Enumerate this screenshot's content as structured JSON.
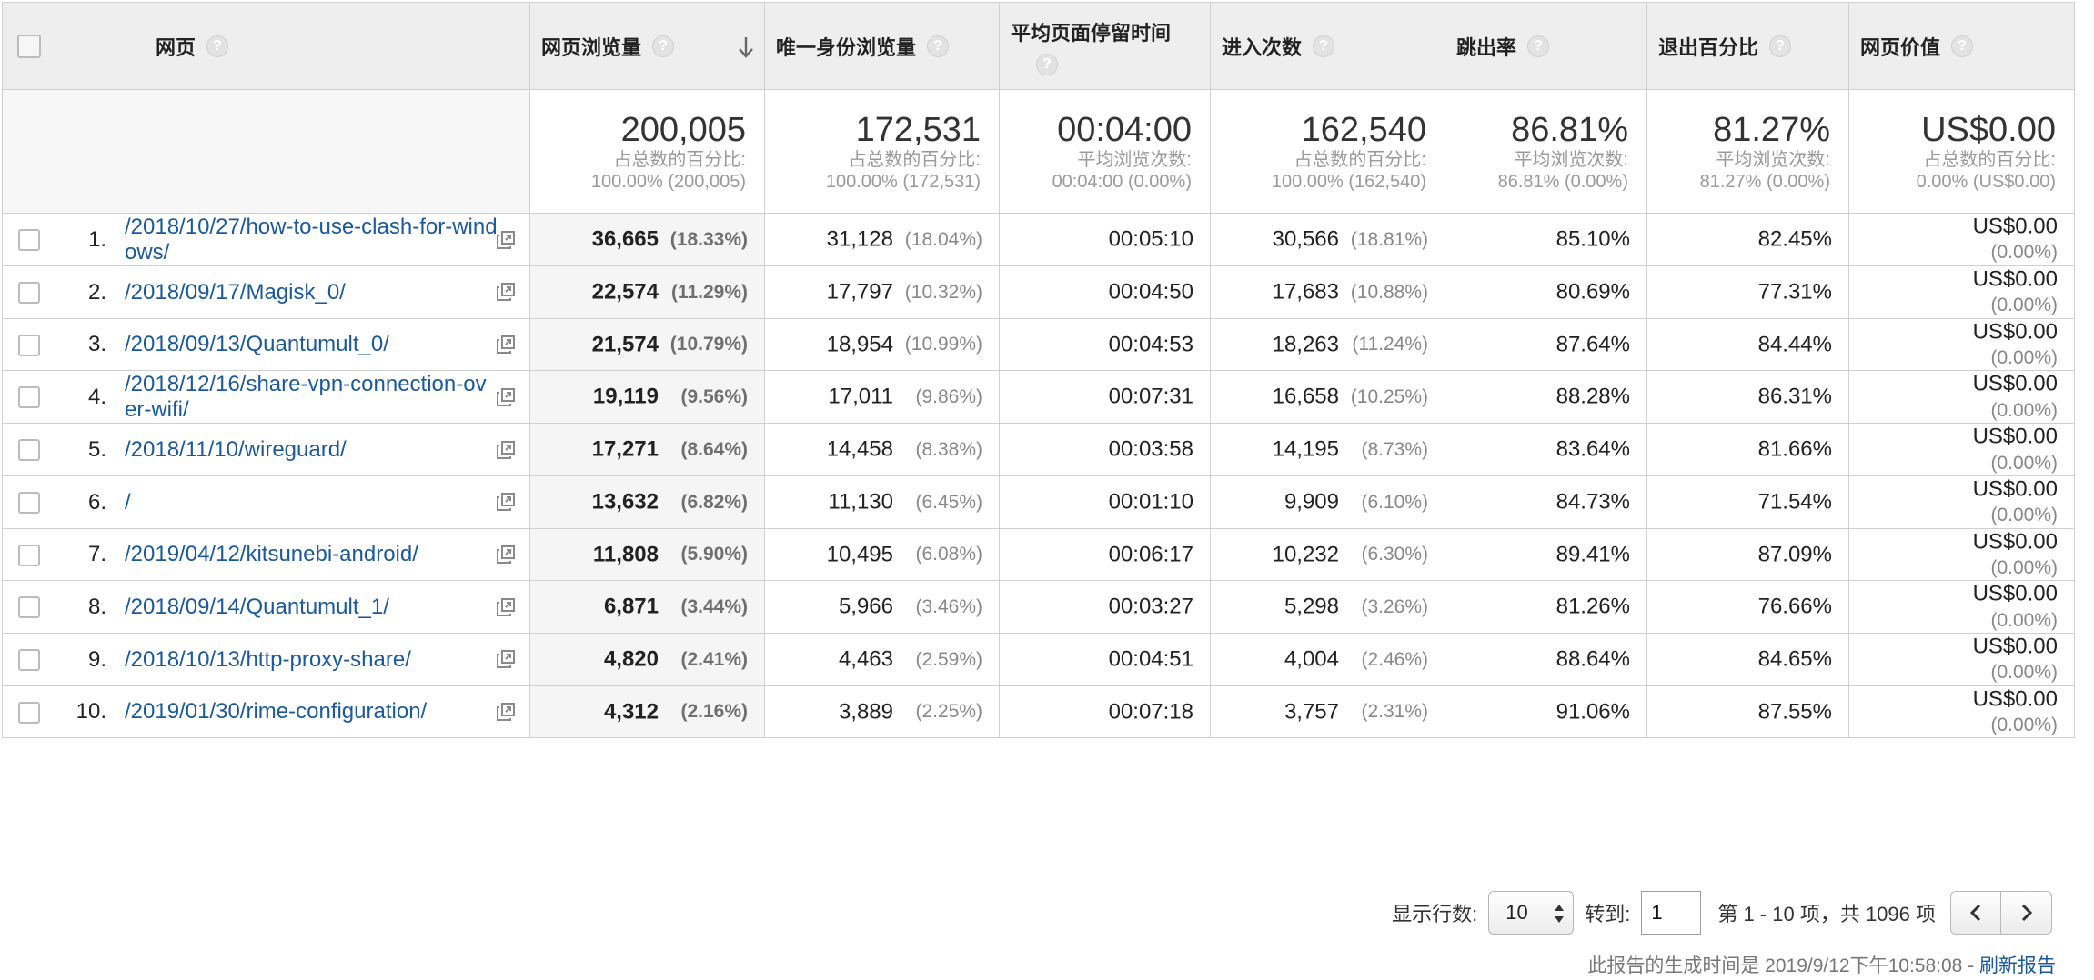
{
  "columns": {
    "page": "网页",
    "pageviews": "网页浏览量",
    "unique": "唯一身份浏览量",
    "avg_time": "平均页面停留时间",
    "entrances": "进入次数",
    "bounce": "跳出率",
    "exit": "退出百分比",
    "value": "网页价值",
    "help_glyph": "?"
  },
  "summary": {
    "pageviews": {
      "big": "200,005",
      "sub1": "占总数的百分比:",
      "sub2": "100.00% (200,005)"
    },
    "unique": {
      "big": "172,531",
      "sub1": "占总数的百分比:",
      "sub2": "100.00% (172,531)"
    },
    "avg_time": {
      "big": "00:04:00",
      "sub1": "平均浏览次数:",
      "sub2": "00:04:00 (0.00%)"
    },
    "entrances": {
      "big": "162,540",
      "sub1": "占总数的百分比:",
      "sub2": "100.00% (162,540)"
    },
    "bounce": {
      "big": "86.81%",
      "sub1": "平均浏览次数:",
      "sub2": "86.81% (0.00%)"
    },
    "exit": {
      "big": "81.27%",
      "sub1": "平均浏览次数:",
      "sub2": "81.27% (0.00%)"
    },
    "value": {
      "big": "US$0.00",
      "sub1": "占总数的百分比:",
      "sub2": "0.00% (US$0.00)"
    }
  },
  "rows": [
    {
      "rank": "1.",
      "page": "/2018/10/27/how-to-use-clash-for-windows/",
      "pv": "36,665",
      "pv_pct": "(18.33%)",
      "uniq": "31,128",
      "uniq_pct": "(18.04%)",
      "time": "00:05:10",
      "ent": "30,566",
      "ent_pct": "(18.81%)",
      "bounce": "85.10%",
      "exit": "82.45%",
      "val": "US$0.00",
      "val_pct": "(0.00%)"
    },
    {
      "rank": "2.",
      "page": "/2018/09/17/Magisk_0/",
      "pv": "22,574",
      "pv_pct": "(11.29%)",
      "uniq": "17,797",
      "uniq_pct": "(10.32%)",
      "time": "00:04:50",
      "ent": "17,683",
      "ent_pct": "(10.88%)",
      "bounce": "80.69%",
      "exit": "77.31%",
      "val": "US$0.00",
      "val_pct": "(0.00%)"
    },
    {
      "rank": "3.",
      "page": "/2018/09/13/Quantumult_0/",
      "pv": "21,574",
      "pv_pct": "(10.79%)",
      "uniq": "18,954",
      "uniq_pct": "(10.99%)",
      "time": "00:04:53",
      "ent": "18,263",
      "ent_pct": "(11.24%)",
      "bounce": "87.64%",
      "exit": "84.44%",
      "val": "US$0.00",
      "val_pct": "(0.00%)"
    },
    {
      "rank": "4.",
      "page": "/2018/12/16/share-vpn-connection-over-wifi/",
      "pv": "19,119",
      "pv_pct": "(9.56%)",
      "uniq": "17,011",
      "uniq_pct": "(9.86%)",
      "time": "00:07:31",
      "ent": "16,658",
      "ent_pct": "(10.25%)",
      "bounce": "88.28%",
      "exit": "86.31%",
      "val": "US$0.00",
      "val_pct": "(0.00%)"
    },
    {
      "rank": "5.",
      "page": "/2018/11/10/wireguard/",
      "pv": "17,271",
      "pv_pct": "(8.64%)",
      "uniq": "14,458",
      "uniq_pct": "(8.38%)",
      "time": "00:03:58",
      "ent": "14,195",
      "ent_pct": "(8.73%)",
      "bounce": "83.64%",
      "exit": "81.66%",
      "val": "US$0.00",
      "val_pct": "(0.00%)"
    },
    {
      "rank": "6.",
      "page": "/",
      "pv": "13,632",
      "pv_pct": "(6.82%)",
      "uniq": "11,130",
      "uniq_pct": "(6.45%)",
      "time": "00:01:10",
      "ent": "9,909",
      "ent_pct": "(6.10%)",
      "bounce": "84.73%",
      "exit": "71.54%",
      "val": "US$0.00",
      "val_pct": "(0.00%)"
    },
    {
      "rank": "7.",
      "page": "/2019/04/12/kitsunebi-android/",
      "pv": "11,808",
      "pv_pct": "(5.90%)",
      "uniq": "10,495",
      "uniq_pct": "(6.08%)",
      "time": "00:06:17",
      "ent": "10,232",
      "ent_pct": "(6.30%)",
      "bounce": "89.41%",
      "exit": "87.09%",
      "val": "US$0.00",
      "val_pct": "(0.00%)"
    },
    {
      "rank": "8.",
      "page": "/2018/09/14/Quantumult_1/",
      "pv": "6,871",
      "pv_pct": "(3.44%)",
      "uniq": "5,966",
      "uniq_pct": "(3.46%)",
      "time": "00:03:27",
      "ent": "5,298",
      "ent_pct": "(3.26%)",
      "bounce": "81.26%",
      "exit": "76.66%",
      "val": "US$0.00",
      "val_pct": "(0.00%)"
    },
    {
      "rank": "9.",
      "page": "/2018/10/13/http-proxy-share/",
      "pv": "4,820",
      "pv_pct": "(2.41%)",
      "uniq": "4,463",
      "uniq_pct": "(2.59%)",
      "time": "00:04:51",
      "ent": "4,004",
      "ent_pct": "(2.46%)",
      "bounce": "88.64%",
      "exit": "84.65%",
      "val": "US$0.00",
      "val_pct": "(0.00%)"
    },
    {
      "rank": "10.",
      "page": "/2019/01/30/rime-configuration/",
      "pv": "4,312",
      "pv_pct": "(2.16%)",
      "uniq": "3,889",
      "uniq_pct": "(2.25%)",
      "time": "00:07:18",
      "ent": "3,757",
      "ent_pct": "(2.31%)",
      "bounce": "91.06%",
      "exit": "87.55%",
      "val": "US$0.00",
      "val_pct": "(0.00%)"
    }
  ],
  "footer": {
    "rows_label": "显示行数:",
    "rows_value": "10",
    "goto_label": "转到:",
    "goto_value": "1",
    "range_text": "第 1 - 10 项，共 1096 项",
    "generated_text": "此报告的生成时间是 2019/9/12下午10:58:08 - ",
    "refresh_label": "刷新报告"
  },
  "colors": {
    "link": "#1a5a9c",
    "header_bg": "#eeeeee",
    "border": "#d0d0d0"
  }
}
